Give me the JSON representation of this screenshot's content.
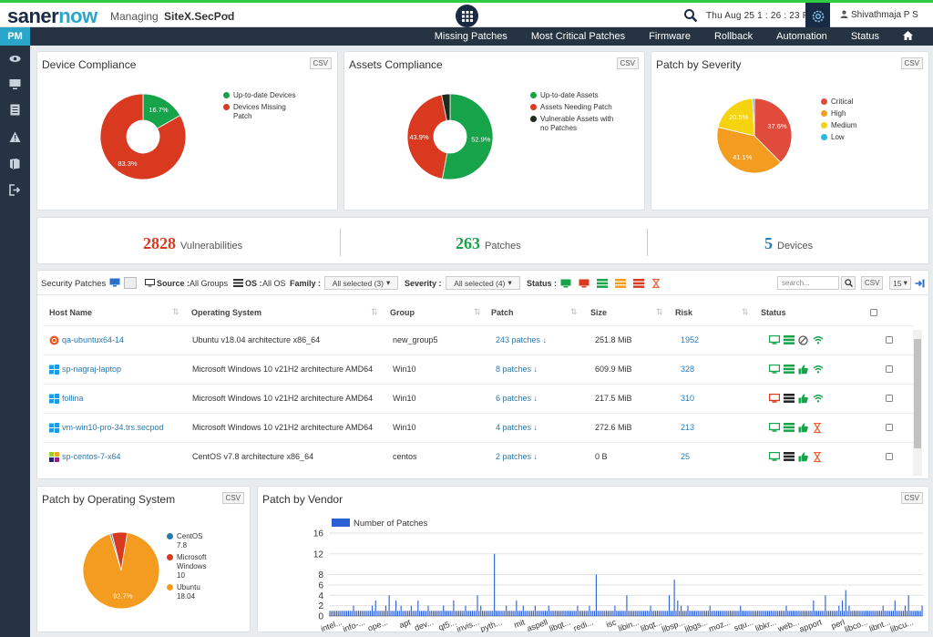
{
  "app": {
    "logo_a": "saner",
    "logo_b": "now",
    "managing": "Managing",
    "site": "SiteX.SecPod",
    "datetime": "Thu Aug 25   1 : 26 : 23 PM",
    "user": "Shivathmaja P S"
  },
  "nav": {
    "module": "PM",
    "items": [
      "Missing Patches",
      "Most Critical Patches",
      "Firmware",
      "Rollback",
      "Automation",
      "Status"
    ]
  },
  "csv_label": "CSV",
  "device_compliance": {
    "title": "Device Compliance",
    "chart_data": {
      "type": "pie",
      "labels": [
        "Up-to-date Devices",
        "Devices Missing Patch"
      ],
      "values": [
        16.7,
        83.3
      ],
      "colors": [
        "#16a34a",
        "#d9391e"
      ],
      "value_labels": [
        "16.7%",
        "83.3%"
      ]
    }
  },
  "assets_compliance": {
    "title": "Assets Compliance",
    "chart_data": {
      "type": "pie",
      "labels": [
        "Up-to-date Assets",
        "Assets Needing Patch",
        "Vulnerable Assets with no Patches"
      ],
      "values": [
        52.9,
        43.9,
        3.2
      ],
      "colors": [
        "#16a34a",
        "#d9391e",
        "#1f2a1f"
      ],
      "value_labels": [
        "52.9%",
        "43.9%",
        ""
      ]
    }
  },
  "patch_severity": {
    "title": "Patch by Severity",
    "chart_data": {
      "type": "pie",
      "labels": [
        "Critical",
        "High",
        "Medium",
        "Low"
      ],
      "values": [
        37.6,
        41.1,
        20.5,
        0.8
      ],
      "colors": [
        "#e04b3b",
        "#f39c1f",
        "#f5d40f",
        "#29b6e8"
      ],
      "value_labels": [
        "37.6%",
        "41.1%",
        "20.5%",
        ""
      ]
    }
  },
  "stats": [
    {
      "value": "2828",
      "label": "Vulnerabilities",
      "color": "#d9391e"
    },
    {
      "value": "263",
      "label": "Patches",
      "color": "#16a34a"
    },
    {
      "value": "5",
      "label": "Devices",
      "color": "#2a7ab0"
    }
  ],
  "filters": {
    "label": "Security Patches",
    "source_label": "Source :",
    "source_value": "All Groups",
    "os_label": "OS :",
    "os_value": "All OS",
    "family_label": "Family :",
    "family_value": "All selected (3)",
    "severity_label": "Severity :",
    "severity_value": "All selected (4)",
    "status_label": "Status :",
    "search_placeholder": "search...",
    "page_size": "15"
  },
  "table": {
    "columns": [
      "Host Name",
      "Operating System",
      "Group",
      "Patch",
      "Size",
      "Risk",
      "Status"
    ],
    "rows": [
      {
        "host": "qa-ubuntux64-14",
        "os_type": "ubuntu",
        "os": "Ubuntu v18.04 architecture x86_64",
        "group": "new_group5",
        "patch": "243 patches",
        "size": "251.8 MiB",
        "risk": "1952",
        "status": [
          "monitor",
          "list",
          "blocked",
          "wifi"
        ]
      },
      {
        "host": "sp-nagraj-laptop",
        "os_type": "windows",
        "os": "Microsoft Windows 10 v21H2 architecture AMD64",
        "group": "Win10",
        "patch": "8 patches",
        "size": "609.9 MiB",
        "risk": "328",
        "status": [
          "monitor",
          "list",
          "thumb",
          "wifi"
        ]
      },
      {
        "host": "follina",
        "os_type": "windows",
        "os": "Microsoft Windows 10 v21H2 architecture AMD64",
        "group": "Win10",
        "patch": "6 patches",
        "size": "217.5 MiB",
        "risk": "310",
        "status": [
          "monitor-red",
          "list-dark",
          "thumb",
          "wifi"
        ]
      },
      {
        "host": "vm-win10-pro-34.trs.secpod",
        "os_type": "windows",
        "os": "Microsoft Windows 10 v21H2 architecture AMD64",
        "group": "Win10",
        "patch": "4 patches",
        "size": "272.6 MiB",
        "risk": "213",
        "status": [
          "monitor",
          "list",
          "thumb",
          "hourglass"
        ]
      },
      {
        "host": "sp-centos-7-x64",
        "os_type": "centos",
        "os": "CentOS v7.8 architecture x86_64",
        "group": "centos",
        "patch": "2 patches",
        "size": "0 B",
        "risk": "25",
        "status": [
          "monitor",
          "list-dark",
          "thumb",
          "hourglass"
        ]
      }
    ]
  },
  "patch_os": {
    "title": "Patch by Operating System",
    "chart_data": {
      "type": "pie",
      "labels": [
        "CentOS 7.8",
        "Microsoft Windows 10",
        "Ubuntu 18.04"
      ],
      "values": [
        0.8,
        6.5,
        92.7
      ],
      "colors": [
        "#2a7ab0",
        "#d9391e",
        "#f39c1f"
      ],
      "value_labels": [
        "",
        "",
        "92.7%"
      ]
    }
  },
  "patch_vendor": {
    "title": "Patch by Vendor",
    "chart_data": {
      "type": "bar",
      "legend": "Number of Patches",
      "color": "#2c5fd6",
      "ylim": [
        0,
        16
      ],
      "yticks": [
        0,
        2,
        4,
        6,
        8,
        12,
        16
      ],
      "x_labels": [
        "intel...",
        "info-...",
        "ope...",
        "apt",
        "dev...",
        "qt5...",
        "invis...",
        "pyth...",
        "mit",
        "aspell",
        "libqt...",
        "redi...",
        "isc",
        "libin...",
        "libqt...",
        "libsp...",
        "libgs...",
        "moz...",
        "squ...",
        "libkr...",
        "web...",
        "apport",
        "perl",
        "libco...",
        "libnt...",
        "libcu..."
      ],
      "values": [
        1,
        1,
        1,
        1,
        1,
        1,
        1,
        1,
        1,
        1,
        1,
        1,
        1,
        1,
        2,
        1,
        1,
        1,
        1,
        1,
        1,
        1,
        1,
        1,
        1,
        2,
        1,
        3,
        1,
        1,
        1,
        1,
        1,
        2,
        1,
        4,
        1,
        1,
        1,
        3,
        1,
        1,
        2,
        1,
        1,
        1,
        1,
        1,
        2,
        1,
        1,
        1,
        3,
        1,
        1,
        1,
        1,
        1,
        2,
        1,
        1,
        1,
        1,
        1,
        1,
        1,
        1,
        2,
        1,
        1,
        1,
        1,
        1,
        3,
        1,
        1,
        1,
        1,
        1,
        1,
        2,
        1,
        1,
        1,
        1,
        1,
        1,
        4,
        1,
        2,
        1,
        1,
        1,
        1,
        1,
        1,
        1,
        12,
        1,
        1,
        1,
        1,
        1,
        1,
        2,
        1,
        1,
        1,
        1,
        1,
        3,
        1,
        1,
        1,
        2,
        1,
        1,
        1,
        1,
        1,
        1,
        2,
        1,
        1,
        1,
        1,
        1,
        1,
        1,
        2,
        1,
        1,
        1,
        1,
        1,
        1,
        1,
        1,
        1,
        1,
        1,
        1,
        1,
        1,
        1,
        1,
        2,
        1,
        1,
        1,
        1,
        1,
        1,
        2,
        1,
        1,
        1,
        8,
        1,
        1,
        1,
        1,
        1,
        1,
        1,
        1,
        1,
        1,
        2,
        1,
        1,
        1,
        1,
        1,
        1,
        4,
        1,
        1,
        1,
        1,
        1,
        1,
        1,
        1,
        1,
        1,
        1,
        1,
        1,
        2,
        1,
        1,
        1,
        1,
        1,
        1,
        1,
        1,
        1,
        1,
        4,
        1,
        1,
        7,
        1,
        3,
        1,
        2,
        1,
        1,
        1,
        2,
        1,
        1,
        1,
        1,
        1,
        1,
        1,
        1,
        1,
        1,
        1,
        1,
        2,
        1,
        1,
        1,
        1,
        1,
        1,
        1,
        1,
        1,
        1,
        1,
        1,
        1,
        1,
        1,
        1,
        1,
        2,
        1,
        1,
        1,
        1,
        1,
        1,
        1,
        1,
        1,
        1,
        1,
        1,
        1,
        1,
        1,
        1,
        1,
        1,
        1,
        1,
        1,
        1,
        1,
        1,
        1,
        1,
        2,
        1,
        1,
        1,
        1,
        1,
        1,
        1,
        1,
        1,
        1,
        1,
        1,
        1,
        1,
        1,
        3,
        1,
        1,
        1,
        1,
        1,
        1,
        4,
        1,
        1,
        1,
        1,
        1,
        1,
        1,
        2,
        1,
        3,
        1,
        5,
        1,
        2,
        1,
        1,
        1,
        1,
        1,
        1,
        1,
        1,
        1,
        1,
        1,
        1,
        1,
        1,
        1,
        1,
        1,
        1,
        1,
        2,
        1,
        1,
        1,
        1,
        1,
        1,
        3,
        1,
        1,
        1,
        1,
        1,
        2,
        1,
        4,
        1,
        1,
        1,
        1,
        1,
        1,
        1,
        2
      ]
    }
  }
}
